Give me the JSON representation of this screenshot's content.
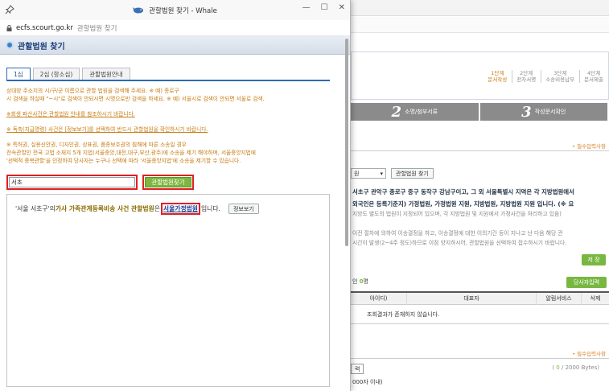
{
  "popup": {
    "window_title": "관할법원 찾기 - Whale",
    "url_host": "ecfs.scourt.go.kr",
    "url_page_title": "관할법원 찾기",
    "header_title": "관할법원 찾기",
    "tabs": [
      {
        "label": "1심",
        "active": true
      },
      {
        "label": "2심 (항소심)",
        "active": false
      },
      {
        "label": "관할법원안내",
        "active": false
      }
    ],
    "guide": {
      "line1": "상대방 주소지의 시/구/군 이름으로 관할 법원을 검색해 주세요. ※ 예) 종로구",
      "line2": "시 검색을 하실때 \"~시\"로 검색이 안되시면 시명으로만 검색을 하세요. ※ 예) 서울시로 검색이 안되면 서울로 검색.",
      "line3": "※회생 파산사건은 관할법원 안내를 참조하시기 바랍니다.",
      "line4": "※ 독촉(지급명령) 사건은 [정보보기]를 선택하여 반드시 관할법원을 확인하시기 바랍니다.",
      "line5": "※ 특허권, 실용신안권, 디자인권, 상표권, 품종보호권의 침해에 따른 소송일 경우",
      "line6": "전속관할인 전국 고법 소재지 5개 지법(서울중앙,대전,대구,부산,광주)에 소송을 제기 해야하며, 서울중앙지법에",
      "line7": "'선택적 중복관할'을 인정하여 당사자는 누구나 선택에 따라 '서울중앙지법'에 소송을 제기할 수 있습니다."
    },
    "search_value": "서초",
    "search_button": "관할법원찾기",
    "result": {
      "pre": "'서울 서초구'의 ",
      "case_type": "가사 가족관계등록비송 사건 관할법원",
      "mid": "은 ",
      "court": "서울가정법원",
      "post": "입니다.",
      "info_button": "정보보기"
    }
  },
  "background": {
    "steps": [
      {
        "num": "1단계",
        "label": "문서작성",
        "active": true
      },
      {
        "num": "2단계",
        "label": "전자서명",
        "active": false
      },
      {
        "num": "3단계",
        "label": "소송비용납부",
        "active": false
      },
      {
        "num": "4단계",
        "label": "문서제출",
        "active": false
      }
    ],
    "bigtabs": [
      {
        "num": "2",
        "label": "소명/첨부서류"
      },
      {
        "num": "3",
        "label": "작성문서확인"
      }
    ],
    "required_note": "• 필수입력사항",
    "court_select": "원",
    "court_button": "관할법원 찾기",
    "info_line1": "서초구 관악구 종로구 중구 동작구 강남구이고, 그 외 서울특별시 지역은 각 지방법원에서",
    "info_line2": "외국인은 등록기준지) 가정법원, 가정법원 지원, 지방법원, 지방법원 지원 입니다. (※ 요",
    "info_line3": "지방도 별도의 법원이 지정되어 있으며, 각 지방법원 및 지원에서 가정사건을 처리하고 있음)",
    "info_line4": "이전 절차에 의하여 이송결정을 하고, 이송결정에 대한 이의기간 등이 지나고 난 다음 해당 관",
    "info_line5": "시간이 발생(2~4주 정도)하므로 이점 양지하시어, 관할법원을 선택하여 접수하시기 바랍니다.",
    "save_button": "저 장",
    "count_prefix": "인 ",
    "count_value": "0",
    "count_suffix": "명",
    "add_party_button": "당사자입력",
    "table_headers": [
      "아이디)",
      "대표자",
      "알림서비스",
      "삭제"
    ],
    "table_empty": "조회결과가 존재하지 않습니다.",
    "required_note2": "• 필수입력사항",
    "input_tab": "력",
    "byte_open": "( ",
    "byte_count": "0",
    "byte_close": " / 2000 Bytes)",
    "limit_text": "000자 이내)"
  },
  "colors": {
    "accent_blue": "#2d6bb3",
    "guide_orange": "#c77c12",
    "button_green": "#7fb63f",
    "highlight_red": "#e02020"
  }
}
